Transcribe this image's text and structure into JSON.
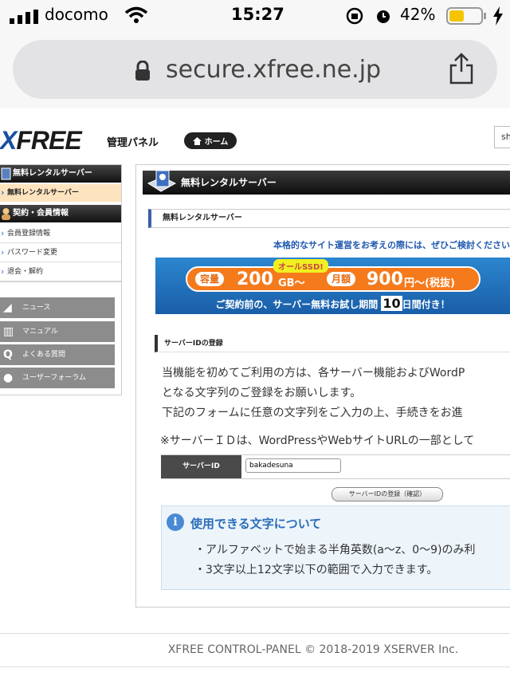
{
  "status_bar": {
    "carrier": "docomo",
    "time": "15:27",
    "battery": "42%"
  },
  "browser": {
    "url": "secure.xfree.ne.jp"
  },
  "header": {
    "logo_x": "X",
    "logo_rest": "FREE",
    "panel_label": "管理パネル",
    "home_label": "ホーム",
    "search_stub": "sh"
  },
  "sidebar": {
    "head1": "無料レンタルサーバー",
    "active_item": "無料レンタルサーバー",
    "head2": "契約・会員情報",
    "links": [
      "会員登録情報",
      "パスワード変更",
      "退会・解約"
    ],
    "buttons": [
      "ニュース",
      "マニュアル",
      "よくある質問",
      "ユーザーフォーラム"
    ]
  },
  "main": {
    "title": "無料レンタルサーバー",
    "subtitle": "無料レンタルサーバー",
    "promo_text": "本格的なサイト運営をお考えの際には、ぜひご検討ください",
    "banner": {
      "ssd": "オールSSD!",
      "capacity_label": "容量",
      "capacity_value": "200",
      "capacity_unit": "GB～",
      "price_label": "月額",
      "price_value": "900",
      "price_unit": "円～(税抜)",
      "bottom_pre": "ご契約前の、サーバー無料お試し期間",
      "bottom_days": "10",
      "bottom_post": "日間付き！"
    },
    "section_title": "サーバーIDの登録",
    "desc_lines": [
      "当機能を初めてご利用の方は、各サーバー機能およびWordP",
      "となる文字列のご登録をお願いします。",
      "下記のフォームに任意の文字列をご入力の上、手続きをお進"
    ],
    "note": "※サーバーＩＤは、WordPressやWebサイトURLの一部として",
    "form": {
      "label": "サーバーID",
      "value": "bakadesuna"
    },
    "confirm_button": "サーバーIDの登録（確認）",
    "info": {
      "title": "使用できる文字について",
      "lines": [
        "・アルファベットで始まる半角英数(a～z、0～9)のみ利",
        "・3文字以上12文字以下の範囲で入力できます。"
      ]
    }
  },
  "footer": "XFREE CONTROL-PANEL © 2018-2019 XSERVER Inc."
}
